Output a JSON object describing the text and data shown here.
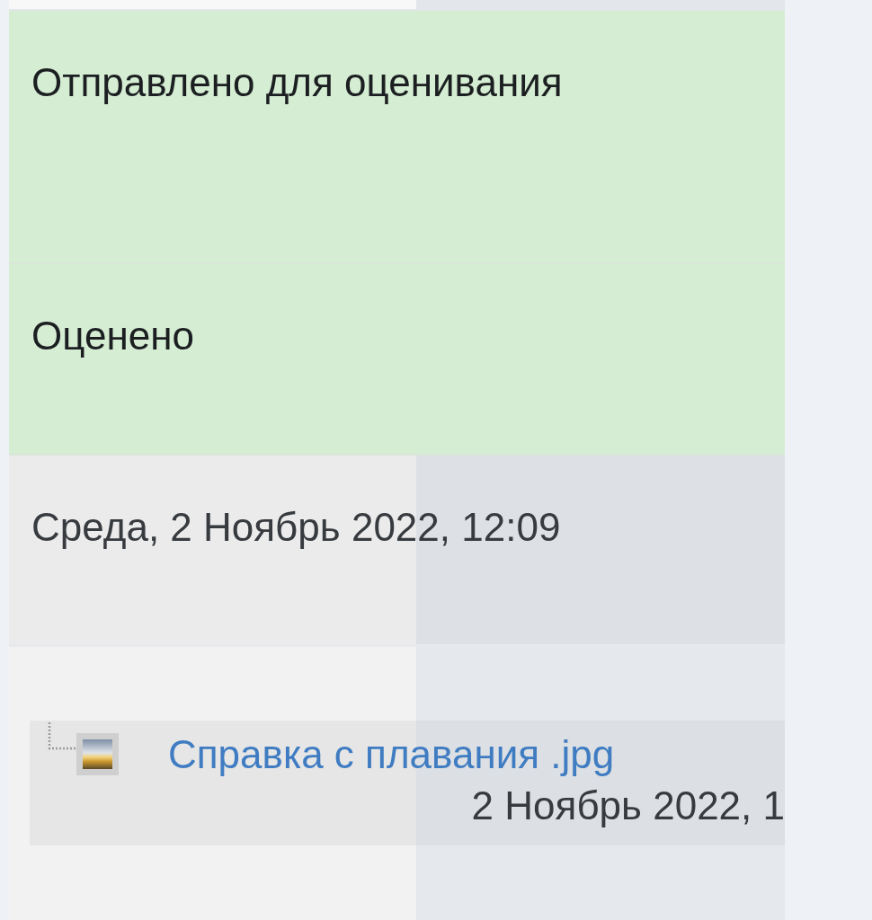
{
  "table": {
    "rows": [
      {
        "kind": "success",
        "text": "Отправлено для оценивания"
      },
      {
        "kind": "success",
        "text": "Оценено"
      },
      {
        "kind": "plain",
        "text": "Среда, 2 Ноябрь 2022, 12:09"
      },
      {
        "kind": "files",
        "files": [
          {
            "name": "Справка с плавания .jpg",
            "date": "2 Ноябрь 2022, 1"
          }
        ]
      }
    ]
  }
}
